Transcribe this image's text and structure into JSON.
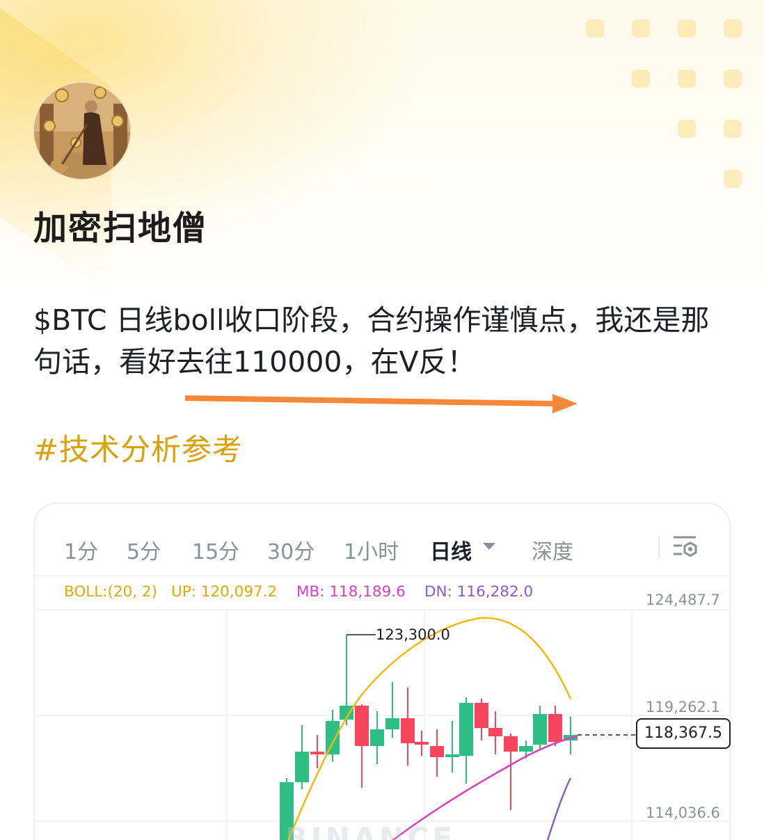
{
  "post": {
    "author": "加密扫地僧",
    "text": "$BTC 日线boll收口阶段，合约操作谨慎点，我还是那句话，看好去往110000，在V反！",
    "hashtag": "#技术分析参考"
  },
  "chart": {
    "tabs": [
      {
        "label": "1分",
        "active": false
      },
      {
        "label": "5分",
        "active": false
      },
      {
        "label": "15分",
        "active": false
      },
      {
        "label": "30分",
        "active": false
      },
      {
        "label": "1小时",
        "active": false
      },
      {
        "label": "日线",
        "active": true
      },
      {
        "label": "深度",
        "active": false
      }
    ],
    "indicator": {
      "boll": "BOLL:(20, 2)",
      "up": "UP: 120,097.2",
      "mb": "MB: 118,189.6",
      "dn": "DN: 116,282.0"
    },
    "price_axis": [
      "124,487.7",
      "119,262.1",
      "114,036.6"
    ],
    "current_price": "118,367.5",
    "high_label": "123,300.0",
    "watermark": "BINANCE",
    "colors": {
      "up": "#2ebd85",
      "down": "#f6465d",
      "boll_up": "#f0b90b",
      "boll_mb": "#d93fbf",
      "boll_dn": "#8b5cc6",
      "accent": "#d9a10a",
      "arrow": "#f7883a"
    }
  }
}
